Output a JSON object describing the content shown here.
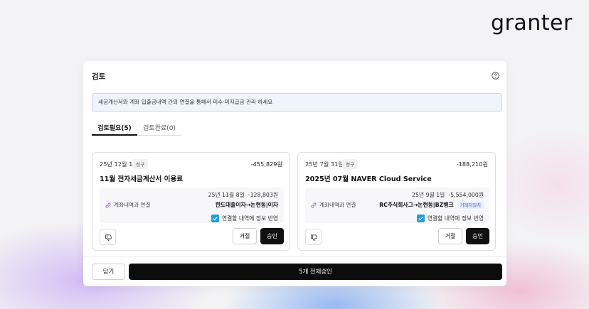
{
  "brand": {
    "logo_text": "granter"
  },
  "modal": {
    "title": "검토",
    "info_banner": "세금계산서와 계좌 입출금내역 간의 연결을 통해서 미수·미지급금 관리 하세요",
    "tabs": [
      {
        "label": "검토필요(5)",
        "active": true
      },
      {
        "label": "검토완료(0)",
        "active": false
      }
    ],
    "cards": [
      {
        "date": "25년 12월 1일",
        "badge": "청구",
        "amount": "-455,829원",
        "title": "11월 전자세금계산서 이용료",
        "link_label": "계좌내역과 연결",
        "tx_date": "25년 11월 8일",
        "tx_amount": "-128,803원",
        "tx_party": "한도대출이자→논현동|이자",
        "mismatch_badge": "",
        "check_label": "연결할 내역에 정보 반영",
        "checked": true,
        "reject_label": "거절",
        "approve_label": "승인"
      },
      {
        "date": "25년 7월 31일",
        "badge": "청구",
        "amount": "-188,210원",
        "title": "2025년 07월 NAVER Cloud Service",
        "link_label": "계좌내역과 연결",
        "tx_date": "25년 9월 1일",
        "tx_amount": "-5,554,000원",
        "tx_party": "RC주식회사그→논현동|BZ뱅크",
        "mismatch_badge": "거래처일치",
        "check_label": "연결할 내역에 정보 반영",
        "checked": true,
        "reject_label": "거절",
        "approve_label": "승인"
      }
    ],
    "footer": {
      "close_label": "닫기",
      "approve_all_label": "5개 전체승인"
    }
  },
  "colors": {
    "accent_checkbox": "#1f9fe0",
    "primary_button": "#111111",
    "banner_bg": "#eef6fb",
    "banner_border": "#b7ddf0",
    "mismatch_badge": "#3a5fcf"
  },
  "icons": {
    "help": "question-circle-icon",
    "link": "link-icon",
    "dislike": "thumbs-down-icon",
    "check": "check-icon"
  }
}
